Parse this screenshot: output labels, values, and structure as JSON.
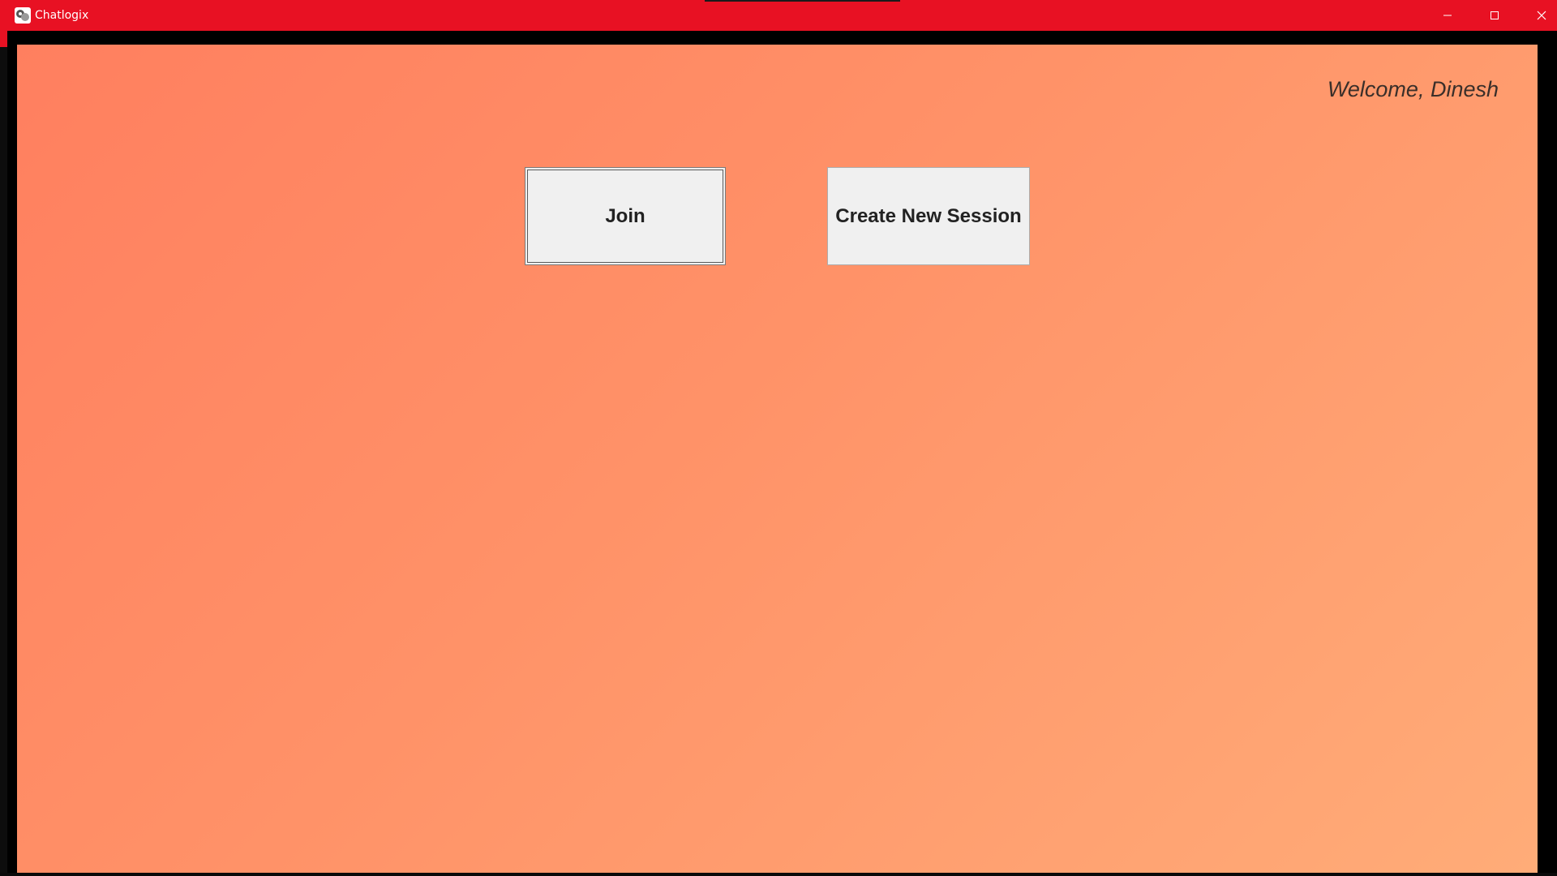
{
  "window": {
    "title": "Chatlogix",
    "accent_color": "#e81123",
    "controls": {
      "minimize_icon": "minimize-icon",
      "maximize_icon": "maximize-icon",
      "close_icon": "close-icon"
    }
  },
  "main": {
    "welcome_text": "Welcome, Dinesh",
    "join_label": "Join",
    "create_session_label": "Create New Session",
    "background_gradient": [
      "#ff7f5f",
      "#ffac78"
    ]
  }
}
